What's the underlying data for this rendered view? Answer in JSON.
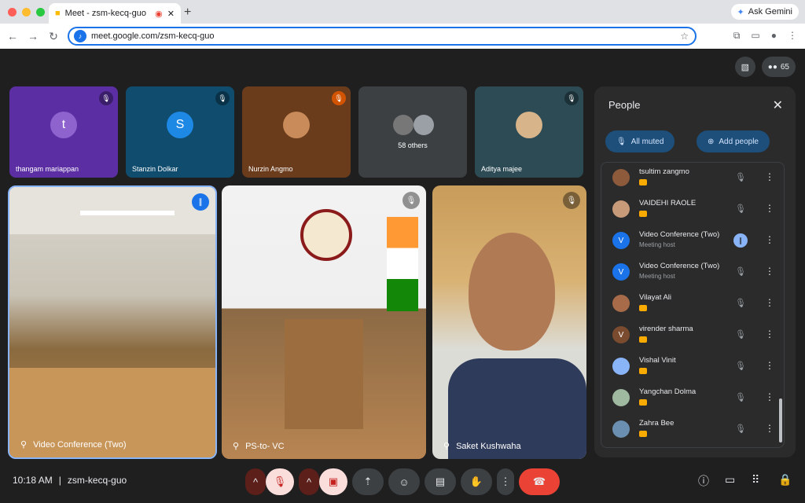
{
  "browser": {
    "tab_title": "Meet - zsm-kecq-guo",
    "url": "meet.google.com/zsm-kecq-guo",
    "ask_gemini": "Ask Gemini"
  },
  "meet": {
    "participant_count": "65",
    "mini_tiles": [
      {
        "name": "thangam mariappan",
        "initial": "t",
        "avatar_color": "#8e63ce",
        "bg": "#5b2fa3"
      },
      {
        "name": "Stanzin Dolkar",
        "initial": "S",
        "avatar_color": "#1e88e5",
        "bg": "#0f4c6e"
      },
      {
        "name": "Nurzin Angmo",
        "initial": "",
        "avatar_color": "#c98b5a",
        "bg": "#6a3c1c"
      },
      {
        "name": "58 others",
        "initial": "",
        "avatar_color": "#777",
        "bg": "#3c4043"
      },
      {
        "name": "Aditya majee",
        "initial": "",
        "avatar_color": "#d8b48a",
        "bg": "#2c4b55"
      }
    ],
    "main_tiles": [
      {
        "name": "Video Conference (Two)"
      },
      {
        "name": "PS-to- VC"
      },
      {
        "name": "Saket Kushwaha"
      }
    ],
    "clock": "10:18 AM",
    "separator": "|",
    "meeting_code": "zsm-kecq-guo"
  },
  "people_panel": {
    "title": "People",
    "all_muted": "All muted",
    "add_people": "Add people",
    "participants": [
      {
        "name": "tsultim zangmo",
        "sub": "",
        "initial": "",
        "color": "#8d5a3c",
        "speaking": false
      },
      {
        "name": "VAIDEHI RAOLE",
        "sub": "",
        "initial": "",
        "color": "#c79a7a",
        "speaking": false
      },
      {
        "name": "Video Conference (Two)",
        "sub": "Meeting host",
        "initial": "V",
        "color": "#1a73e8",
        "speaking": true
      },
      {
        "name": "Video Conference (Two)",
        "sub": "Meeting host",
        "initial": "V",
        "color": "#1a73e8",
        "speaking": false
      },
      {
        "name": "Vilayat Ali",
        "sub": "",
        "initial": "",
        "color": "#a76b4a",
        "speaking": false
      },
      {
        "name": "virender sharma",
        "sub": "",
        "initial": "V",
        "color": "#7a4b2e",
        "speaking": false
      },
      {
        "name": "Vishal Vinit",
        "sub": "",
        "initial": "",
        "color": "#8ab4f8",
        "speaking": false
      },
      {
        "name": "Yangchan Dolma",
        "sub": "",
        "initial": "",
        "color": "#9fb8a0",
        "speaking": false
      },
      {
        "name": "Zahra Bee",
        "sub": "",
        "initial": "",
        "color": "#6a8fb0",
        "speaking": false
      }
    ]
  },
  "colors": {
    "leave_button": "#ea4335",
    "muted_button": "#f9dedc",
    "accent": "#1a73e8"
  }
}
